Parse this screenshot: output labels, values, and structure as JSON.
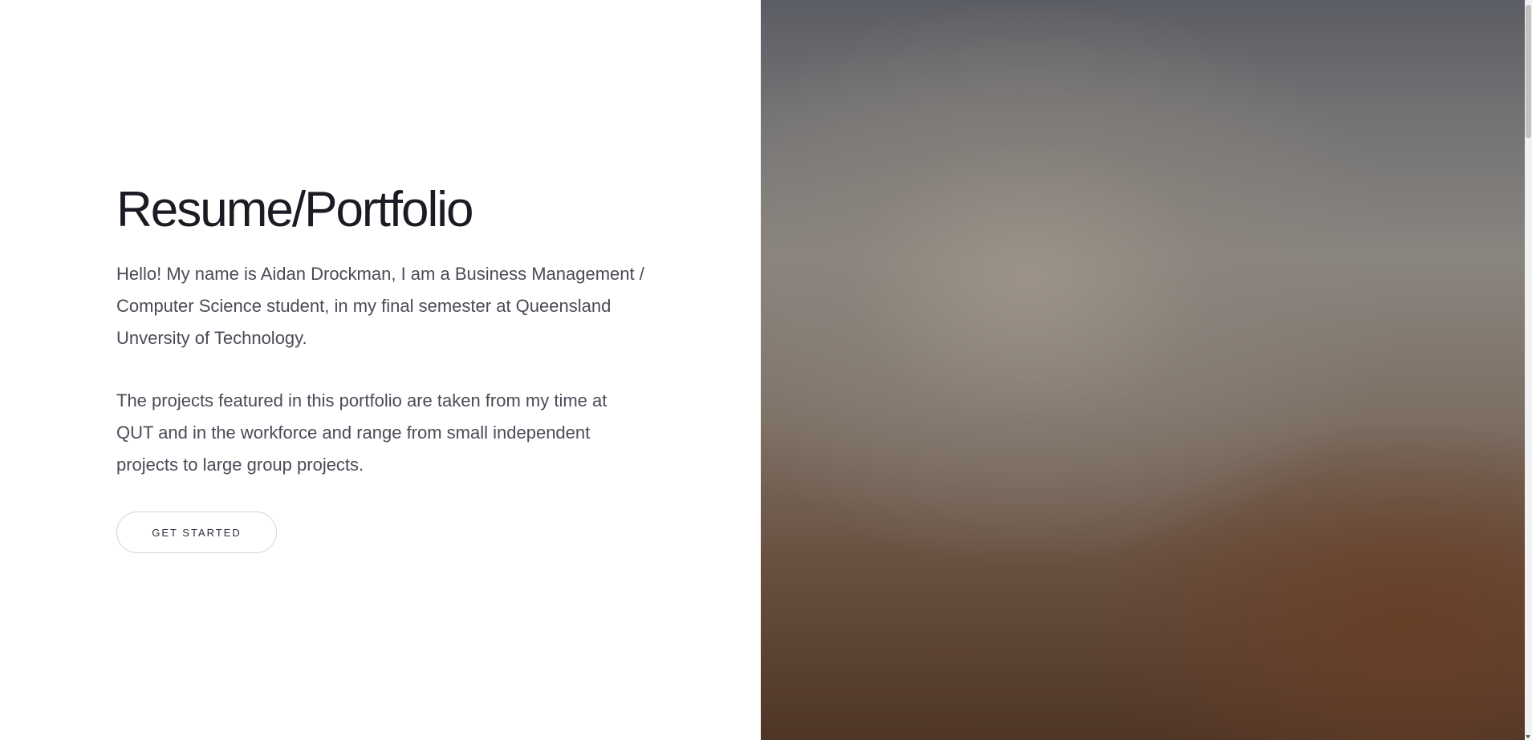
{
  "hero": {
    "title": "Resume/Portfolio",
    "paragraph_1": "Hello! My name is Aidan Drockman, I am a Business Management / Computer Science student, in my final semester at Queensland Unversity of Technology.",
    "paragraph_2": "The projects featured in this portfolio are taken from my time at QUT and in the workforce and range from small independent projects to large group projects.",
    "cta_label": "GET STARTED"
  },
  "colors": {
    "title": "#1b1b24",
    "body_text": "#4c4a56",
    "button_border": "#d5d5db",
    "image_top": "#5b5d64",
    "image_bottom": "#4e3526"
  }
}
